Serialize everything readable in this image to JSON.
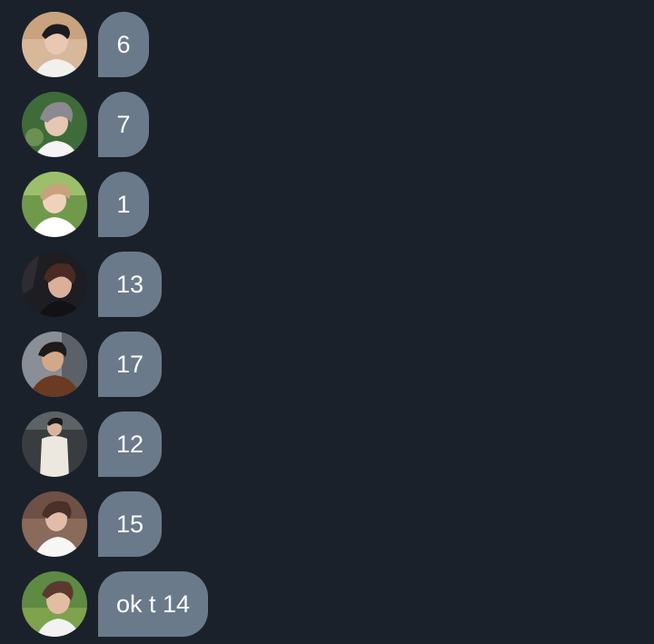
{
  "theme": {
    "background": "#1a212b",
    "bubble_color": "#6a7a8a",
    "text_color": "#ffffff"
  },
  "messages": [
    {
      "text": "6",
      "avatar": "avatar-photo-1"
    },
    {
      "text": "7",
      "avatar": "avatar-photo-2"
    },
    {
      "text": "1",
      "avatar": "avatar-photo-3"
    },
    {
      "text": "13",
      "avatar": "avatar-photo-4"
    },
    {
      "text": "17",
      "avatar": "avatar-photo-5"
    },
    {
      "text": "12",
      "avatar": "avatar-photo-6"
    },
    {
      "text": "15",
      "avatar": "avatar-photo-7"
    },
    {
      "text": "ok t 14",
      "avatar": "avatar-photo-8"
    }
  ]
}
